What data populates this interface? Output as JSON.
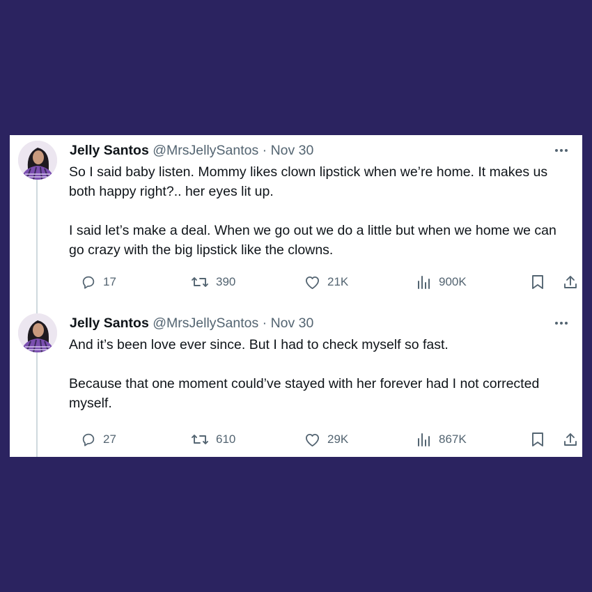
{
  "tweets": [
    {
      "name": "Jelly Santos",
      "handle": "@MrsJellySantos",
      "date": "· Nov 30",
      "paragraphs": [
        "So I said baby listen. Mommy likes clown lipstick when we’re home. It makes us both happy right?.. her eyes lit up.",
        "I said let’s make a deal. When we go out we do a little but when we home we can go crazy with the big lipstick like the clowns."
      ],
      "replies": "17",
      "retweets": "390",
      "likes": "21K",
      "views": "900K"
    },
    {
      "name": "Jelly Santos",
      "handle": "@MrsJellySantos",
      "date": "· Nov 30",
      "paragraphs": [
        "And it’s been love ever since. But I had to check myself so fast.",
        "Because that one moment could’ve stayed with her forever had I not corrected myself."
      ],
      "replies": "27",
      "retweets": "610",
      "likes": "29K",
      "views": "867K"
    }
  ],
  "colors": {
    "background": "#2b2360",
    "card": "#ffffff",
    "text": "#0f1419",
    "secondary": "#536471",
    "thread_line": "#cfd9de"
  },
  "icons": [
    "reply-icon",
    "retweet-icon",
    "like-icon",
    "views-icon",
    "bookmark-icon",
    "share-icon",
    "more-icon"
  ]
}
